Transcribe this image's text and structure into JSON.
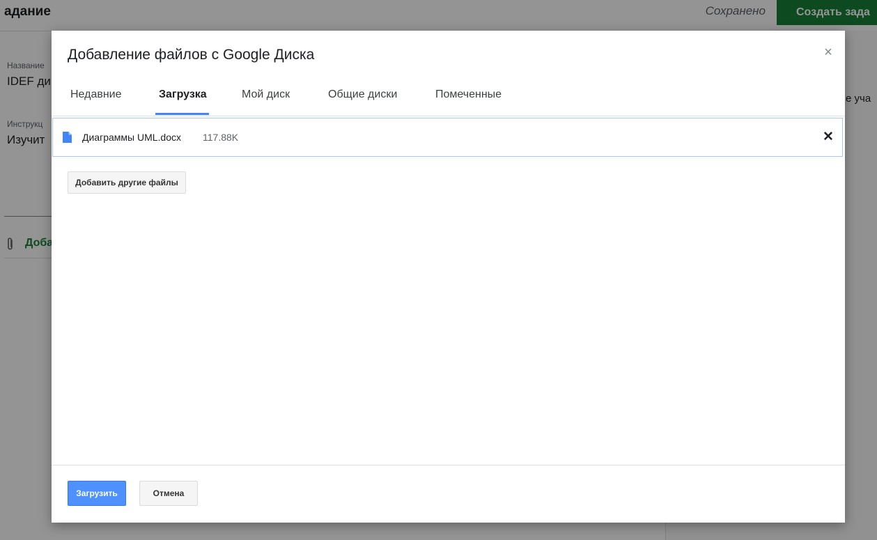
{
  "background": {
    "header_title": "адание",
    "saved_status": "Сохранено",
    "create_button_label": "Создать зада",
    "name_label": "Название",
    "name_value": "IDEF ди",
    "instructions_label": "Инструкц",
    "instructions_value": "Изучит",
    "add_label": "Доба",
    "right_text": "е уча"
  },
  "dialog": {
    "title": "Добавление файлов с Google Диска",
    "close_glyph": "×",
    "tabs": [
      {
        "label": "Недавние",
        "active": false
      },
      {
        "label": "Загрузка",
        "active": true
      },
      {
        "label": "Мой диск",
        "active": false
      },
      {
        "label": "Общие диски",
        "active": false
      },
      {
        "label": "Помеченные",
        "active": false
      }
    ],
    "file": {
      "name": "Диаграммы UML.docx",
      "size": "117.88K",
      "icon": "document-icon",
      "remove_glyph": "✕"
    },
    "add_more_label": "Добавить другие файлы",
    "upload_label": "Загрузить",
    "cancel_label": "Отмена"
  },
  "colors": {
    "accent_blue": "#4285f4",
    "upload_button": "#4d90fe",
    "create_button_green": "#188038",
    "file_icon_blue": "#4285f4"
  }
}
